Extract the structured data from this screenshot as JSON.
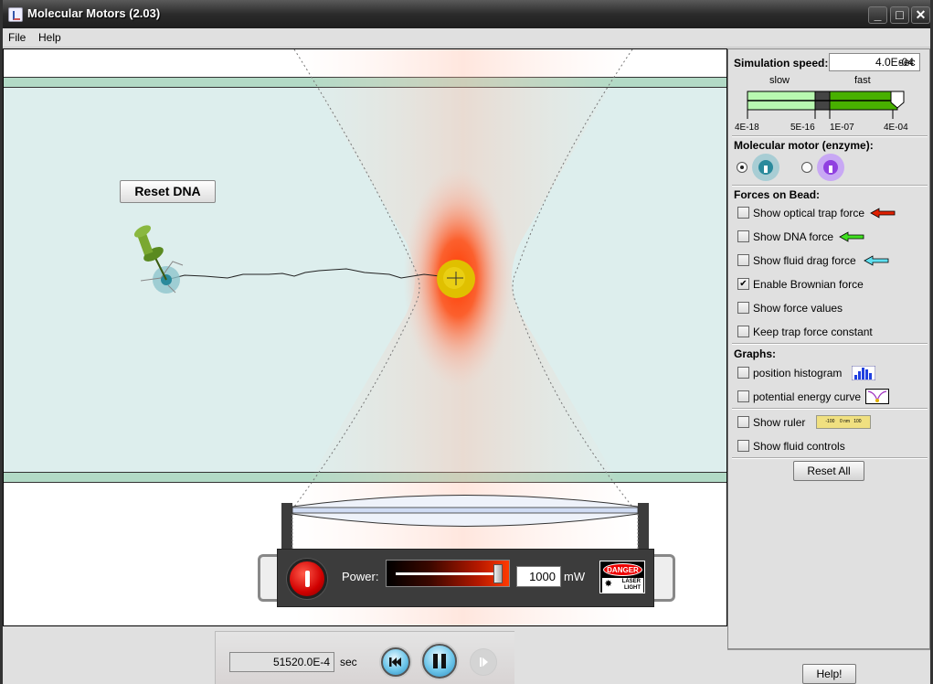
{
  "window": {
    "title": "Molecular Motors (2.03)",
    "controls": [
      "minimize",
      "maximize",
      "close"
    ],
    "minimize_glyph": "_",
    "maximize_glyph": "□",
    "close_glyph": "✕"
  },
  "menu": {
    "items": [
      "File",
      "Help"
    ]
  },
  "canvas": {
    "reset_dna_label": "Reset DNA",
    "colors": {
      "fluid": "#ddeeed",
      "glass": "#b2dac6",
      "bead": "#e0c000",
      "laser": "#ff3a00"
    }
  },
  "laser": {
    "power_label": "Power:",
    "power_value": "1000",
    "power_unit": "mW",
    "power_fraction": 1.0,
    "danger_label": "DANGER",
    "laser_light_label1": "LASER",
    "laser_light_label2": "LIGHT"
  },
  "side": {
    "speed": {
      "label": "Simulation speed:",
      "value": "4.0E-04",
      "unit": "sec",
      "slow_label": "slow",
      "fast_label": "fast",
      "ticks": [
        "4E-18",
        "5E-16",
        "1E-07",
        "4E-04"
      ],
      "slider_position": "max"
    },
    "motor": {
      "title": "Molecular motor (enzyme):",
      "options": [
        {
          "name": "enzyme-a",
          "color": "#2a8a9c",
          "selected": true
        },
        {
          "name": "enzyme-b",
          "color": "#9040e0",
          "selected": false
        }
      ]
    },
    "forces": {
      "title": "Forces on Bead:",
      "items": [
        {
          "label": "Show optical trap force",
          "checked": false,
          "arrow_color": "#e02000"
        },
        {
          "label": "Show DNA force",
          "checked": false,
          "arrow_color": "#40e020"
        },
        {
          "label": "Show fluid drag force",
          "checked": false,
          "arrow_color": "#60e0f0"
        },
        {
          "label": "Enable Brownian force",
          "checked": true
        },
        {
          "label": "Show force values",
          "checked": false
        },
        {
          "label": "Keep trap force constant",
          "checked": false
        }
      ]
    },
    "graphs": {
      "title": "Graphs:",
      "items": [
        {
          "label": "position histogram",
          "checked": false
        },
        {
          "label": "potential energy curve",
          "checked": false
        }
      ]
    },
    "misc": {
      "items": [
        {
          "label": "Show ruler",
          "checked": false,
          "ruler_text": "-100    0 nm   100"
        },
        {
          "label": "Show fluid controls",
          "checked": false
        }
      ]
    },
    "reset_all_label": "Reset All",
    "help_label": "Help!"
  },
  "clock": {
    "time_value": "51520.0E-4",
    "time_unit": "sec",
    "check_glyph": "✔"
  }
}
